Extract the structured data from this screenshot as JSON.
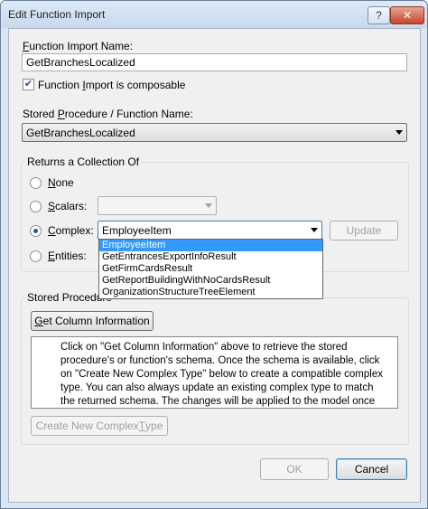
{
  "window": {
    "title": "Edit Function Import",
    "help_button": "?",
    "close_button": "✕"
  },
  "function_import_name": {
    "label_key": "F",
    "label_rest": "unction Import Name:",
    "value": "GetBranchesLocalized"
  },
  "composable": {
    "checked": true,
    "label_pre": "Function ",
    "label_key": "I",
    "label_rest": "mport is composable"
  },
  "stored_procedure": {
    "label_pre": "Stored ",
    "label_key": "P",
    "label_rest": "rocedure / Function Name:",
    "value": "GetBranchesLocalized"
  },
  "returns": {
    "group_title": "Returns a Collection Of",
    "options": [
      {
        "id": "none",
        "label_key": "N",
        "label_rest": "one",
        "checked": false
      },
      {
        "id": "scalars",
        "label_key": "S",
        "label_rest": "calars:",
        "checked": false
      },
      {
        "id": "complex",
        "label_key": "C",
        "label_rest": "omplex:",
        "checked": true
      },
      {
        "id": "entities",
        "label_key": "E",
        "label_rest": "ntities:",
        "checked": false
      }
    ],
    "scalars_value": "",
    "complex_value": "EmployeeItem",
    "update_button": "Update",
    "complex_dropdown_items": [
      {
        "label": "EmployeeItem",
        "selected": true
      },
      {
        "label": "GetEntrancesExportInfoResult",
        "selected": false
      },
      {
        "label": "GetFirmCardsResult",
        "selected": false
      },
      {
        "label": "GetReportBuildingWithNoCardsResult",
        "selected": false
      },
      {
        "label": "OrganizationStructureTreeElement",
        "selected": false
      }
    ]
  },
  "column_info": {
    "group_title": "Stored Procedure",
    "get_button_key": "G",
    "get_button_rest": "et Column Information",
    "info_text": "Click on \"Get Column Information\" above to retrieve the stored procedure's or function's schema. Once the schema is available, click on \"Create New Complex Type\" below to create a compatible complex type. You can also always update an existing complex type to match the returned schema. The changes will be applied to the model once you ...",
    "create_button_pre": "Create New Complex ",
    "create_button_key": "T",
    "create_button_rest": "ype"
  },
  "footer": {
    "ok_button": "OK",
    "cancel_button": "Cancel"
  }
}
